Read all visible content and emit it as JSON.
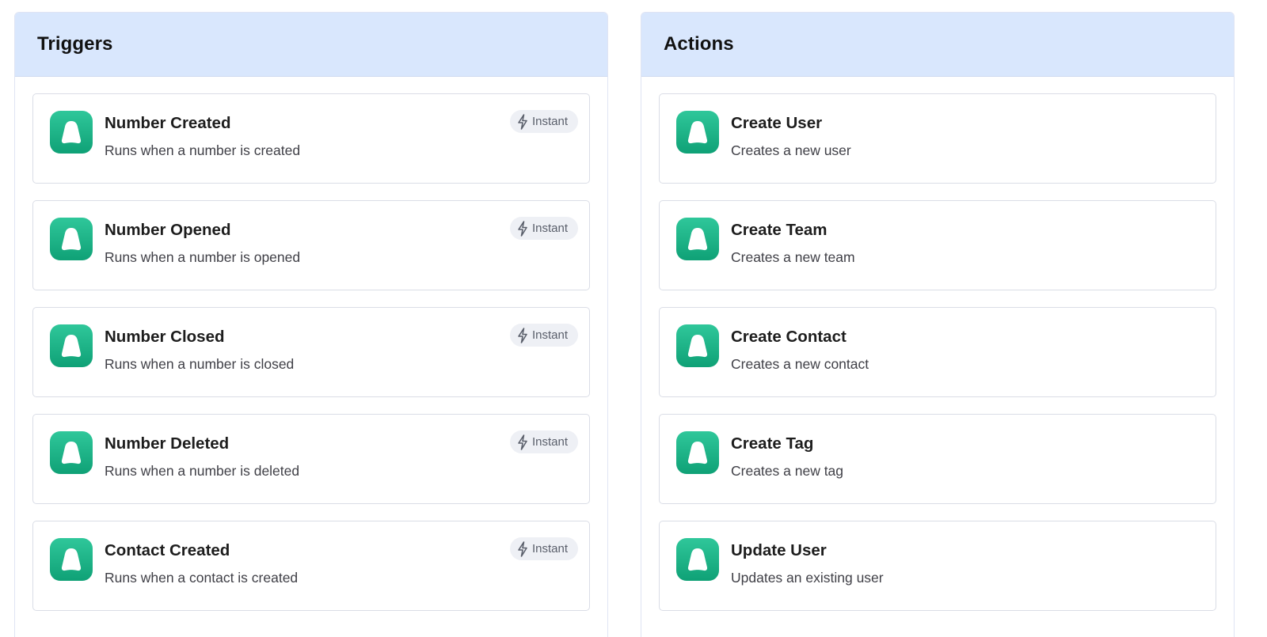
{
  "triggers": {
    "title": "Triggers",
    "items": [
      {
        "name": "Number Created",
        "description": "Runs when a number is created",
        "badge": "Instant",
        "badge_icon": "bolt-icon"
      },
      {
        "name": "Number Opened",
        "description": "Runs when a number is opened",
        "badge": "Instant",
        "badge_icon": "bolt-icon"
      },
      {
        "name": "Number Closed",
        "description": "Runs when a number is closed",
        "badge": "Instant",
        "badge_icon": "bolt-icon"
      },
      {
        "name": "Number Deleted",
        "description": "Runs when a number is deleted",
        "badge": "Instant",
        "badge_icon": "bolt-icon"
      },
      {
        "name": "Contact Created",
        "description": "Runs when a contact is created",
        "badge": "Instant",
        "badge_icon": "bolt-icon"
      }
    ]
  },
  "actions": {
    "title": "Actions",
    "items": [
      {
        "name": "Create User",
        "description": "Creates a new user"
      },
      {
        "name": "Create Team",
        "description": "Creates a new team"
      },
      {
        "name": "Create Contact",
        "description": "Creates a new contact"
      },
      {
        "name": "Create Tag",
        "description": "Creates a new tag"
      },
      {
        "name": "Update User",
        "description": "Updates an existing user"
      }
    ]
  },
  "app_icon": "aircall-app-icon",
  "colors": {
    "header_bg": "#d9e7fd",
    "icon_gradient_top": "#2fc79a",
    "icon_gradient_bottom": "#0fa176",
    "badge_bg": "#eef0f5"
  }
}
